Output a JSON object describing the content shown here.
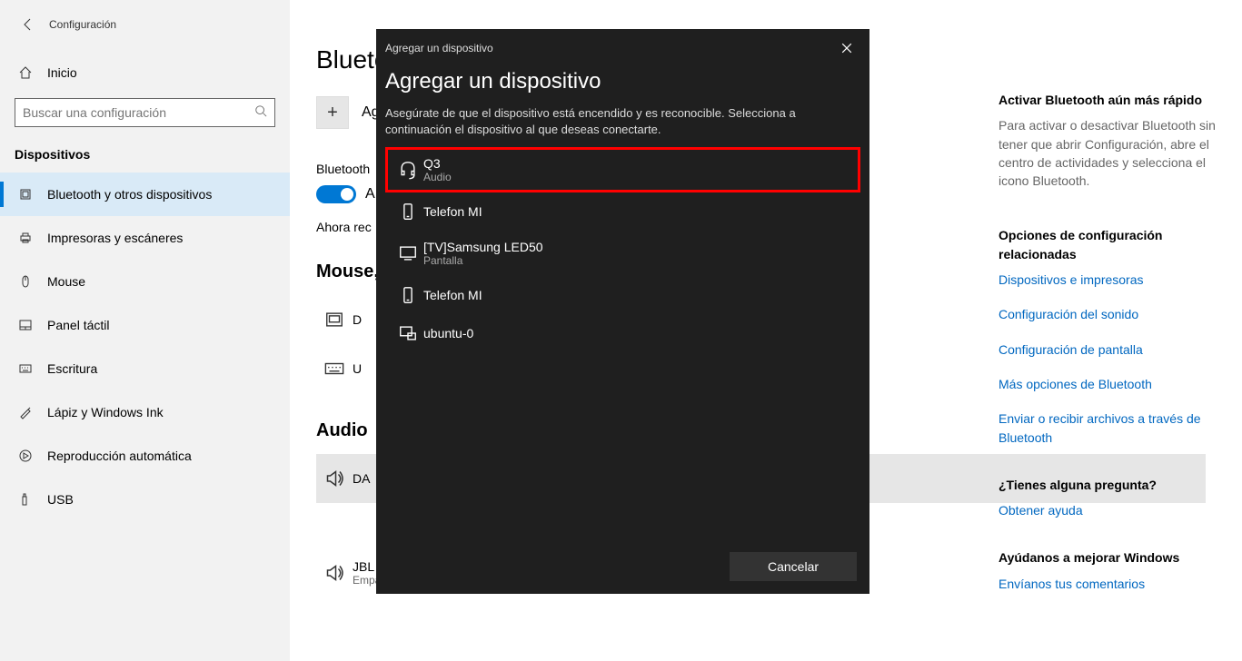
{
  "window": {
    "title": "Configuración"
  },
  "sidebar": {
    "home": "Inicio",
    "search_placeholder": "Buscar una configuración",
    "group": "Dispositivos",
    "items": [
      {
        "label": "Bluetooth y otros dispositivos"
      },
      {
        "label": "Impresoras y escáneres"
      },
      {
        "label": "Mouse"
      },
      {
        "label": "Panel táctil"
      },
      {
        "label": "Escritura"
      },
      {
        "label": "Lápiz y Windows Ink"
      },
      {
        "label": "Reproducción automática"
      },
      {
        "label": "USB"
      }
    ]
  },
  "main": {
    "page_title_short": "Bluetooth",
    "add_label": "Agregar Bluetooth u otro dispositivo",
    "add_label_short": "Ag",
    "bluetooth_label": "Bluetooth",
    "toggle_state": "A",
    "discover_label": "Ahora rec",
    "section_mouse": "Mouse,",
    "section_audio": "Audio",
    "dev_d": "D",
    "dev_u": "U",
    "dev_da": "DA",
    "dev_jbl_name": "JBL Xtreme",
    "dev_jbl_sub": "Emparejado"
  },
  "right": {
    "tip_h": "Activar Bluetooth aún más rápido",
    "tip_txt": "Para activar o desactivar Bluetooth sin tener que abrir Configuración, abre el centro de actividades y selecciona el icono Bluetooth.",
    "related_h": "Opciones de configuración relacionadas",
    "links": [
      "Dispositivos e impresoras",
      "Configuración del sonido",
      "Configuración de pantalla",
      "Más opciones de Bluetooth",
      "Enviar o recibir archivos a través de Bluetooth"
    ],
    "help_h": "¿Tienes alguna pregunta?",
    "help_link": "Obtener ayuda",
    "improve_h": "Ayúdanos a mejorar Windows",
    "improve_link": "Envíanos tus comentarios"
  },
  "modal": {
    "top_title": "Agregar un dispositivo",
    "title": "Agregar un dispositivo",
    "desc": "Asegúrate de que el dispositivo está encendido y es reconocible. Selecciona a continuación el dispositivo al que deseas conectarte.",
    "devices": [
      {
        "name": "Q3",
        "sub": "Audio",
        "icon": "headset"
      },
      {
        "name": "Telefon MI",
        "sub": "",
        "icon": "phone"
      },
      {
        "name": "[TV]Samsung LED50",
        "sub": "Pantalla",
        "icon": "monitor"
      },
      {
        "name": "Telefon MI",
        "sub": "",
        "icon": "phone"
      },
      {
        "name": "ubuntu-0",
        "sub": "",
        "icon": "computer"
      }
    ],
    "cancel": "Cancelar"
  }
}
